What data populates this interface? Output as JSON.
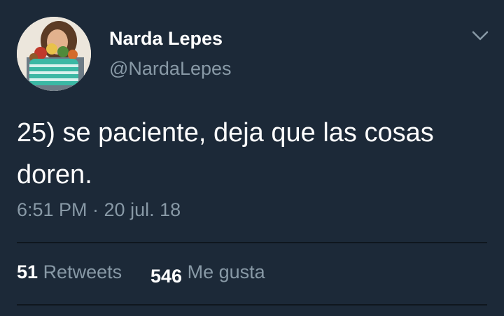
{
  "author": {
    "name": "Narda Lepes",
    "handle": "@NardaLepes"
  },
  "tweet": {
    "text": "25) se paciente, deja que las cosas doren.",
    "timestamp": "6:51 PM · 20 jul. 18"
  },
  "stats": {
    "retweets_count": "51",
    "retweets_label": "Retweets",
    "likes_count": "546",
    "likes_label": "Me gusta"
  },
  "icons": {
    "menu": "chevron-down-icon"
  },
  "colors": {
    "background": "#1c2938",
    "primary_text": "#ffffff",
    "secondary_text": "#8899a6",
    "divider": "#0f161e"
  }
}
